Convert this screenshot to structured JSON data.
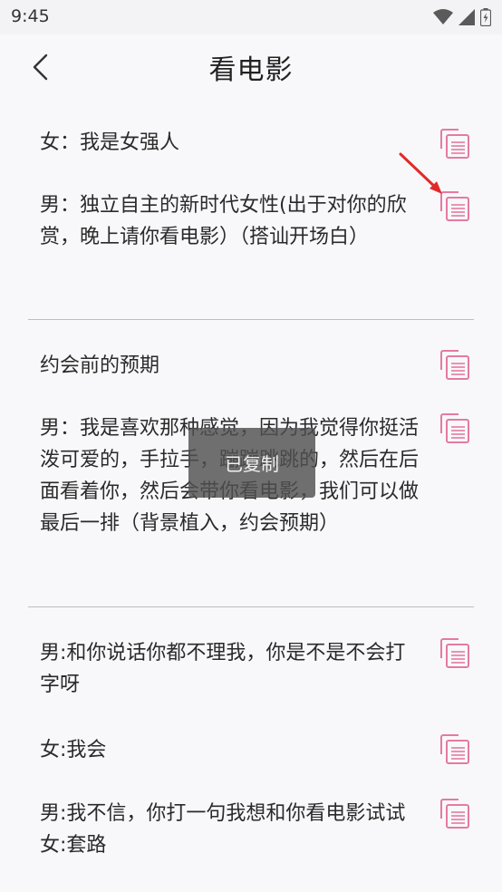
{
  "status_bar": {
    "time": "9:45"
  },
  "header": {
    "title": "看电影",
    "back_icon": "chevron-left-icon"
  },
  "entries": [
    {
      "text": "女：我是女强人"
    },
    {
      "text": "男：独立自主的新时代女性(出于对你的欣赏，晚上请你看电影）（搭讪开场白）"
    },
    {
      "text": "约会前的预期"
    },
    {
      "text": "男：我是喜欢那种感觉，因为我觉得你挺活泼可爱的，手拉手，蹦蹦跳跳的，然后在后面看着你，然后会带你看电影，我们可以做最后一排（背景植入，约会预期）"
    },
    {
      "text": "男:和你说话你都不理我，你是不是不会打字呀"
    },
    {
      "text": "女:我会"
    },
    {
      "text": "男:我不信，你打一句我想和你看电影试试女:套路"
    }
  ],
  "toast": {
    "text": "已复制"
  },
  "colors": {
    "accent_pink": "#e57aa2",
    "arrow_red": "#e02a2a",
    "divider": "#bdbdbd",
    "background": "#f8f8fa"
  },
  "icons": {
    "copy": "copy-icon",
    "wifi": "wifi-icon",
    "signal": "signal-icon",
    "battery": "battery-icon"
  }
}
